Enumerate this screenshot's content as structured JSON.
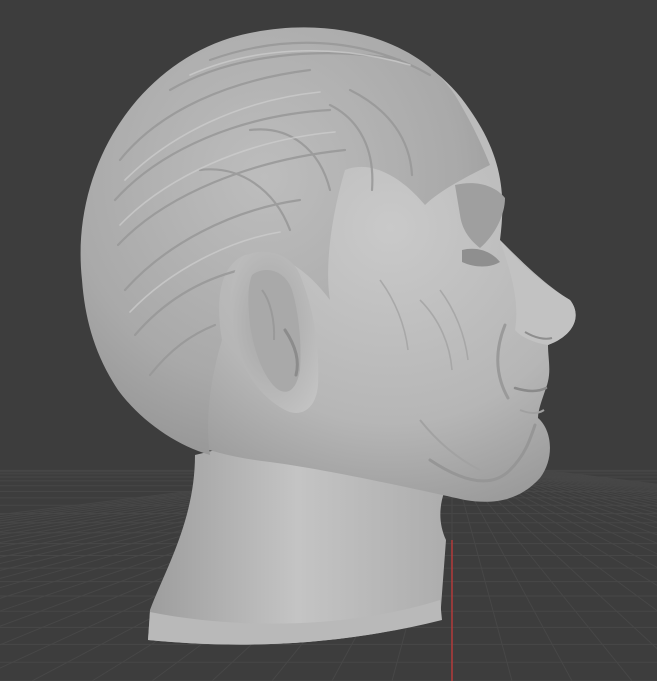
{
  "viewport": {
    "background_color": "#3d3d3d",
    "grid_line_color": "#474747",
    "y_axis_color": "#b33b3b",
    "model_base_color": "#b8b8b8"
  },
  "model": {
    "icon": "sculpted-head-icon",
    "shading": "solid"
  }
}
